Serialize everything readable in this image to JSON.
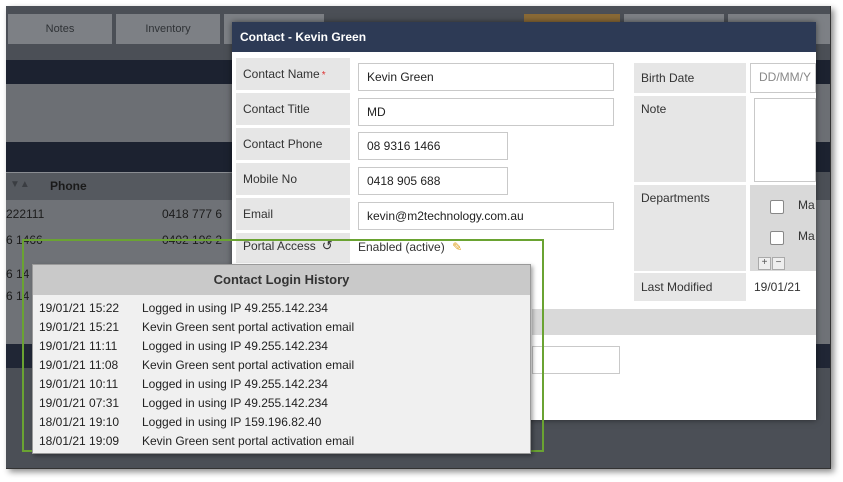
{
  "background": {
    "tabs": [
      "Notes",
      "Inventory"
    ],
    "phone_header": "Phone",
    "rows": [
      {
        "left": "222111",
        "right": "0418 777 6"
      },
      {
        "left": "6 1466",
        "right": "0402 196 2"
      },
      {
        "left": "6 14",
        "right": ""
      },
      {
        "left": "6 14",
        "right": ""
      }
    ]
  },
  "dialog": {
    "title": "Contact - Kevin Green",
    "fields": {
      "contact_name": {
        "label": "Contact Name",
        "value": "Kevin Green",
        "required_mark": "*"
      },
      "contact_title": {
        "label": "Contact Title",
        "value": "MD"
      },
      "contact_phone": {
        "label": "Contact Phone",
        "value": "08 9316 1466"
      },
      "mobile_no": {
        "label": "Mobile No",
        "value": "0418 905 688"
      },
      "email": {
        "label": "Email",
        "value": "kevin@m2technology.com.au"
      },
      "portal_access": {
        "label": "Portal Access",
        "value": "Enabled (active)"
      }
    },
    "right": {
      "birth_date": {
        "label": "Birth Date",
        "placeholder": "DD/MM/Y"
      },
      "note": {
        "label": "Note"
      },
      "departments": {
        "label": "Departments",
        "items": [
          "Ma",
          "Ma"
        ],
        "add": "+",
        "remove": "−"
      },
      "last_modified": {
        "label": "Last Modified",
        "value": "19/01/21"
      }
    }
  },
  "login_history": {
    "title": "Contact Login History",
    "entries": [
      {
        "date": "19/01/21 15:22",
        "message": "Logged in using IP 49.255.142.234"
      },
      {
        "date": "19/01/21 15:21",
        "message": "Kevin Green sent portal activation email"
      },
      {
        "date": "19/01/21 11:11",
        "message": "Logged in using IP 49.255.142.234"
      },
      {
        "date": "19/01/21 11:08",
        "message": "Kevin Green sent portal activation email"
      },
      {
        "date": "19/01/21 10:11",
        "message": "Logged in using IP 49.255.142.234"
      },
      {
        "date": "19/01/21 07:31",
        "message": "Logged in using IP 49.255.142.234"
      },
      {
        "date": "18/01/21 19:10",
        "message": "Logged in using IP 159.196.82.40"
      },
      {
        "date": "18/01/21 19:09",
        "message": "Kevin Green sent portal activation email"
      }
    ]
  },
  "colors": {
    "highlight": "#6aa332",
    "title_bar": "#2d3a55"
  }
}
